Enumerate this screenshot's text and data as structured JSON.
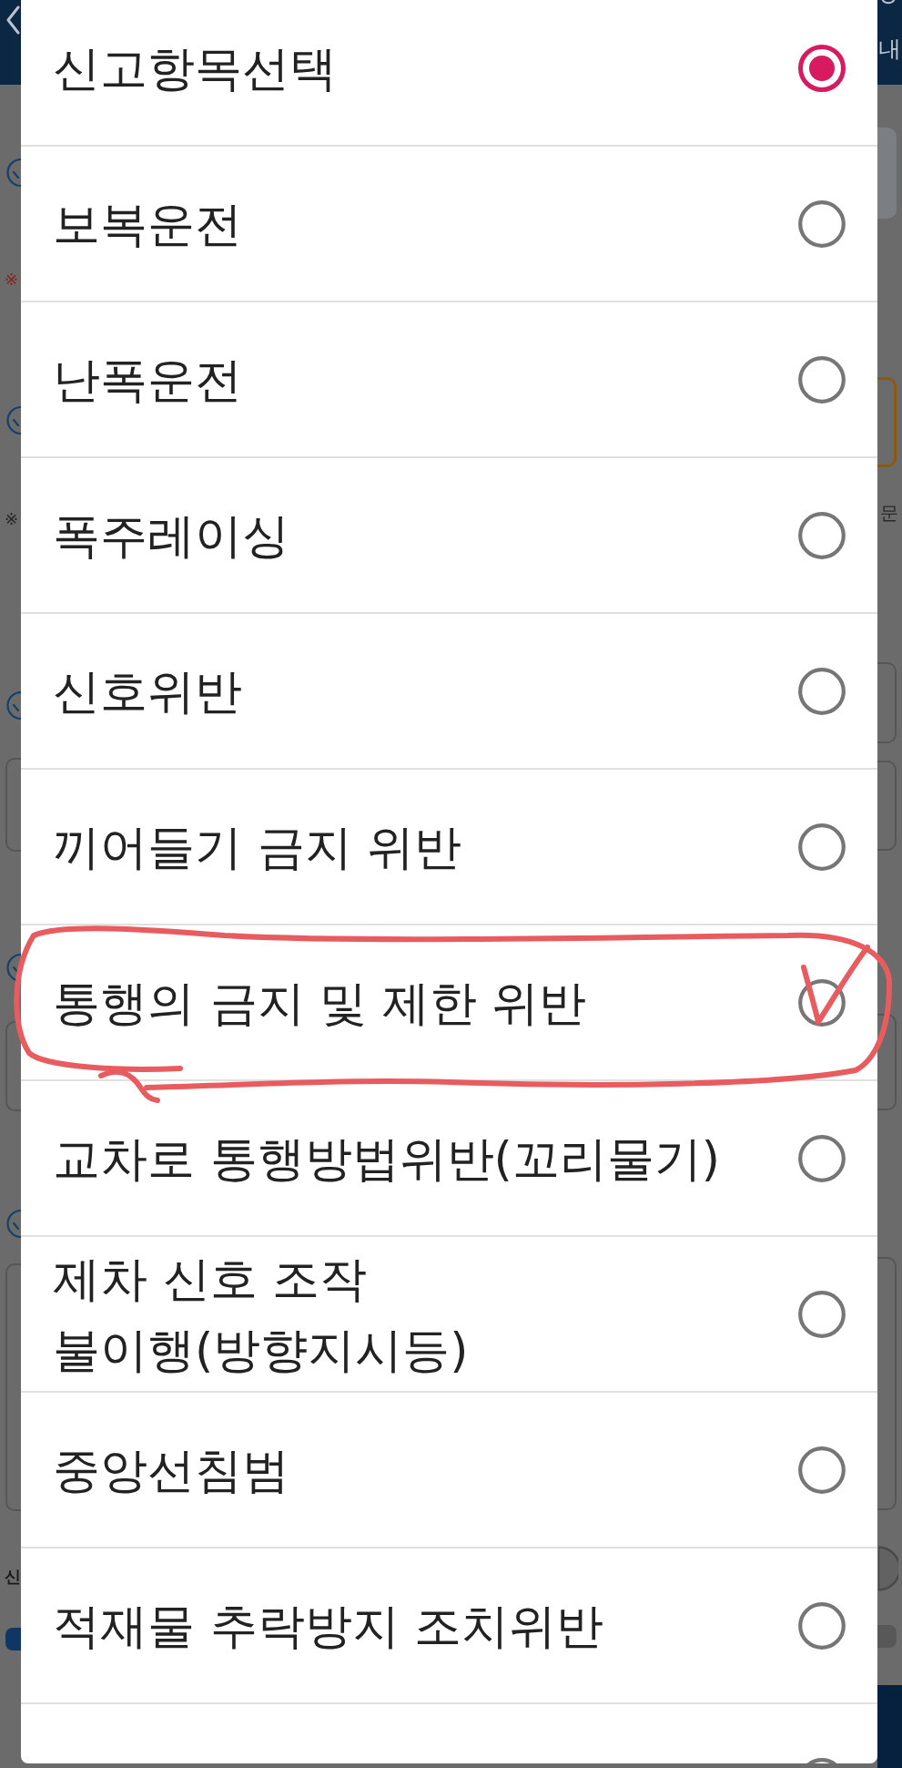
{
  "background_page": {
    "header": {
      "text": "내"
    },
    "left_edge": [
      {
        "kind": "check-circle"
      },
      {
        "kind": "mark",
        "text": "※",
        "color": "#8e1c1c"
      },
      {
        "kind": "check-circle"
      },
      {
        "kind": "mark",
        "text": "※",
        "color": "#262626"
      },
      {
        "kind": "check-circle"
      },
      {
        "kind": "field",
        "highlighted": false
      },
      {
        "kind": "check-circle"
      },
      {
        "kind": "field",
        "highlighted": false
      },
      {
        "kind": "check-circle"
      },
      {
        "kind": "field",
        "highlighted": false
      },
      {
        "kind": "text",
        "text": "신"
      },
      {
        "kind": "bar"
      }
    ],
    "right_edge": [
      {
        "kind": "tile"
      },
      {
        "kind": "field",
        "highlighted": true
      },
      {
        "kind": "text",
        "text": "문"
      },
      {
        "kind": "field",
        "highlighted": false
      },
      {
        "kind": "field",
        "highlighted": false
      },
      {
        "kind": "field",
        "highlighted": false
      },
      {
        "kind": "field",
        "highlighted": false
      },
      {
        "kind": "ring"
      },
      {
        "kind": "bar"
      },
      {
        "kind": "bottom-bar"
      }
    ]
  },
  "dialog": {
    "options": [
      {
        "label": "신고항목선택",
        "selected": true,
        "annotated": false
      },
      {
        "label": "보복운전",
        "selected": false,
        "annotated": false
      },
      {
        "label": "난폭운전",
        "selected": false,
        "annotated": false
      },
      {
        "label": "폭주레이싱",
        "selected": false,
        "annotated": false
      },
      {
        "label": "신호위반",
        "selected": false,
        "annotated": false
      },
      {
        "label": "끼어들기 금지 위반",
        "selected": false,
        "annotated": false
      },
      {
        "label": "통행의 금지 및 제한 위반",
        "selected": false,
        "annotated": true
      },
      {
        "label": "교차로 통행방법위반(꼬리물기)",
        "selected": false,
        "annotated": false
      },
      {
        "label": "제차 신호 조작 불이행(방향지시등)",
        "selected": false,
        "annotated": false
      },
      {
        "label": "중앙선침범",
        "selected": false,
        "annotated": false
      },
      {
        "label": "적재물 추락방지 조치위반",
        "selected": false,
        "annotated": false
      },
      {
        "selected": false,
        "annotated": false
      }
    ]
  }
}
